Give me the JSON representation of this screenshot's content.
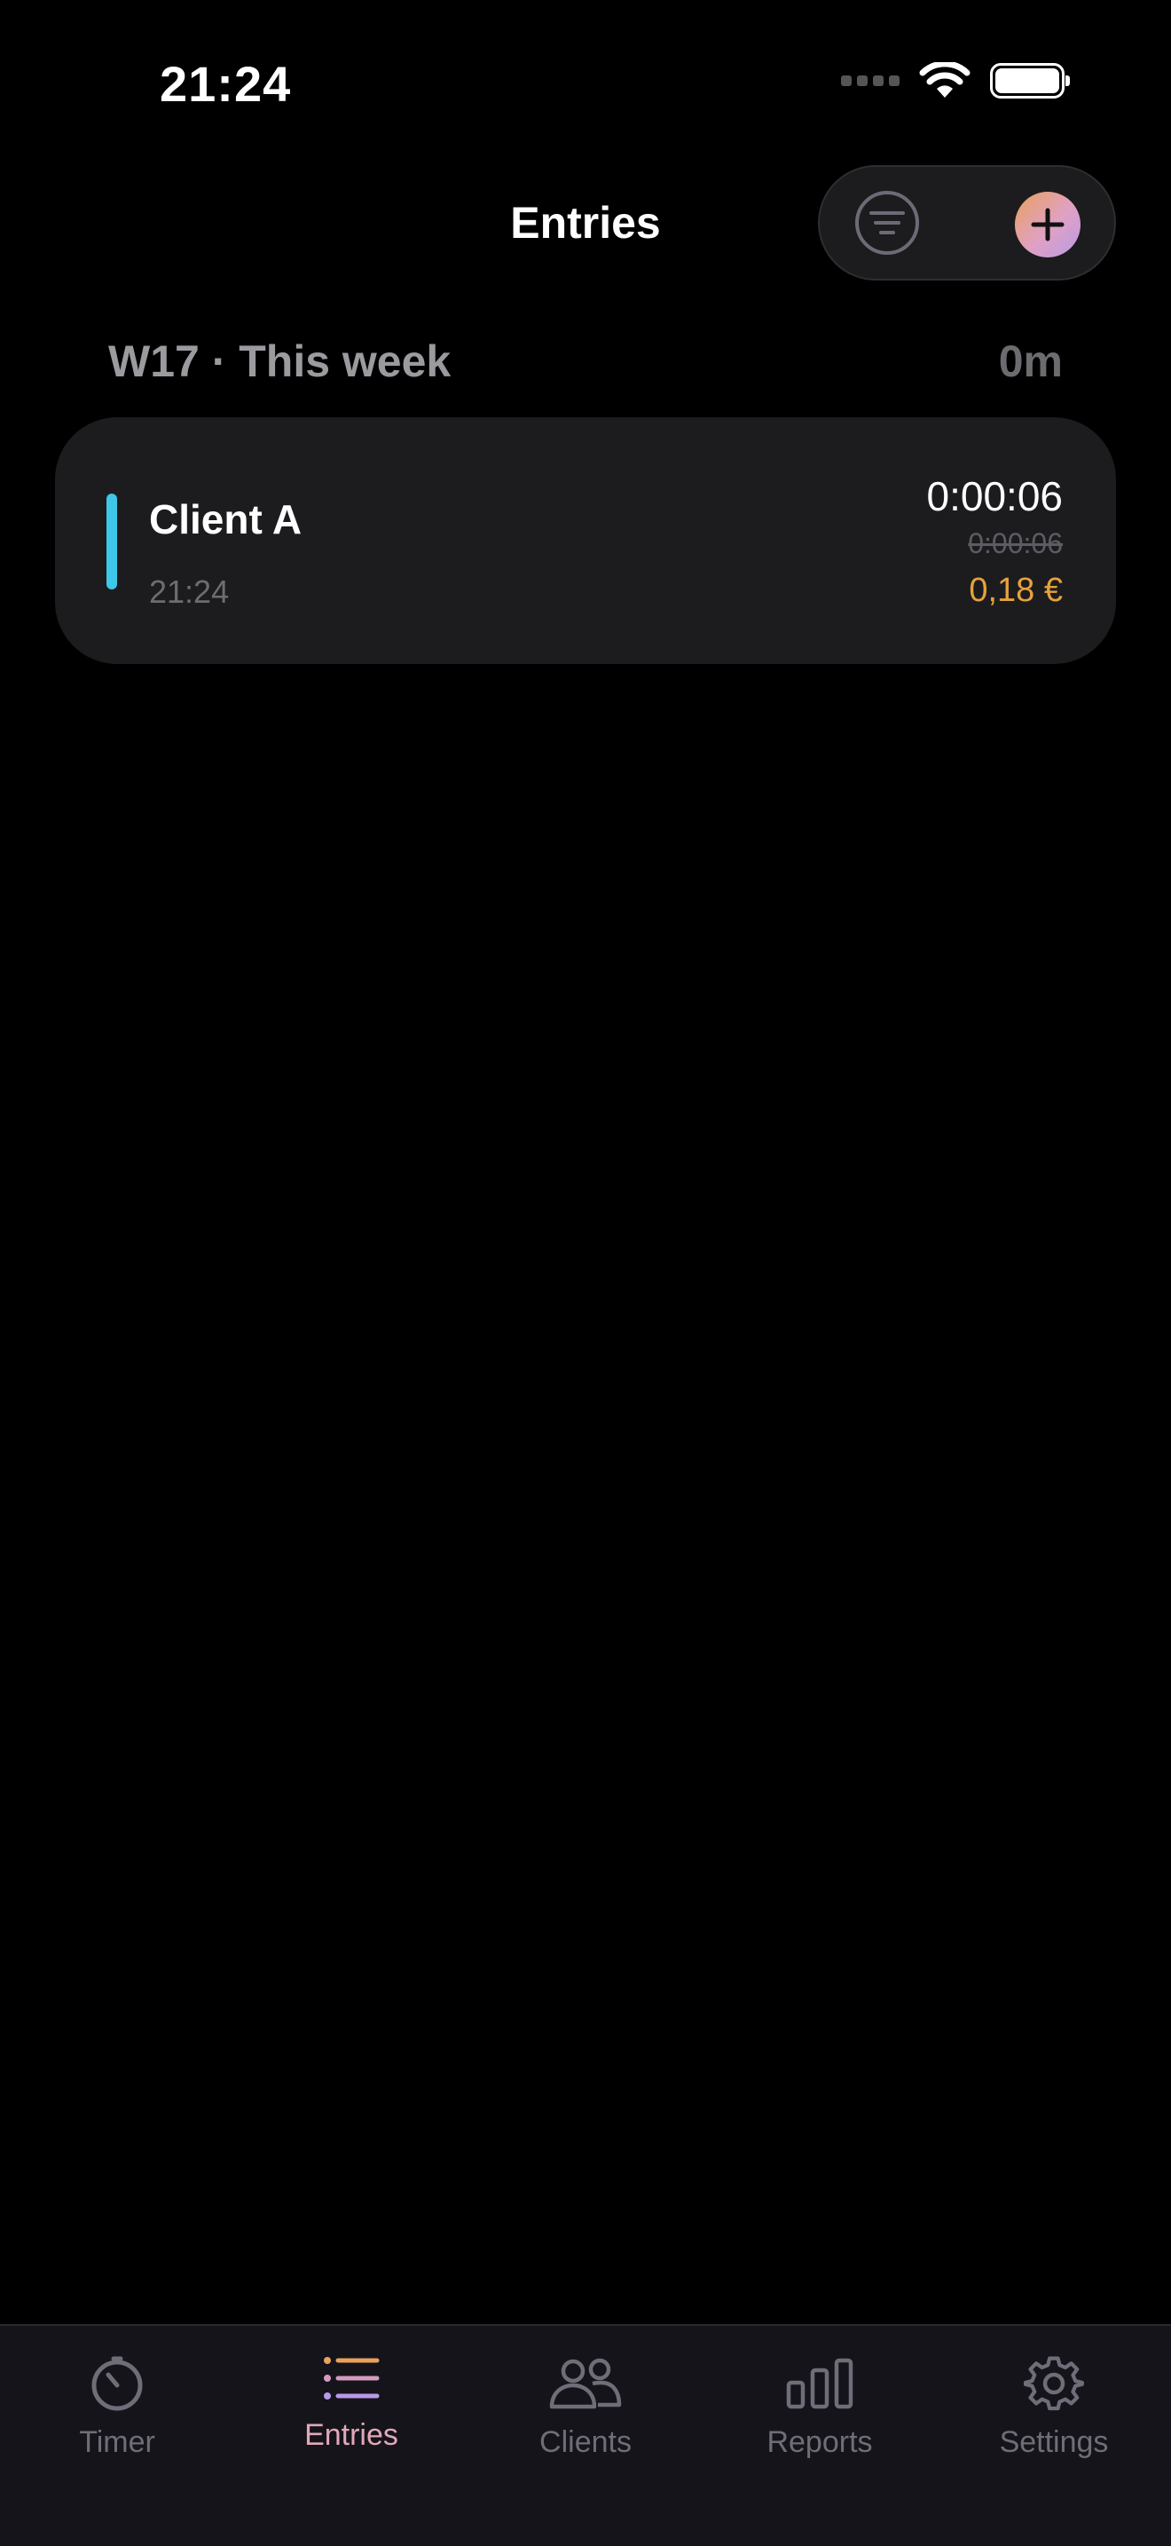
{
  "status_bar": {
    "time": "21:24"
  },
  "header": {
    "title": "Entries",
    "filter_icon": "filter-circle-icon",
    "add_icon": "plus-icon"
  },
  "week": {
    "label": "W17 · This week",
    "total": "0m"
  },
  "entries": [
    {
      "client": "Client A",
      "start_time": "21:24",
      "duration": "0:00:06",
      "rounded_duration": "0:00:06",
      "amount": "0,18 €",
      "client_color": "#3ec7e8"
    }
  ],
  "colors": {
    "accent": "#e6a23c",
    "active_tab": "#e2a8b8",
    "inactive_tab": "#6e6d78",
    "card": "#1c1c1e"
  },
  "tabs": [
    {
      "label": "Timer",
      "icon": "stopwatch-icon",
      "active": false
    },
    {
      "label": "Entries",
      "icon": "list-icon",
      "active": true
    },
    {
      "label": "Clients",
      "icon": "people-icon",
      "active": false
    },
    {
      "label": "Reports",
      "icon": "bar-chart-icon",
      "active": false
    },
    {
      "label": "Settings",
      "icon": "gear-icon",
      "active": false
    }
  ]
}
